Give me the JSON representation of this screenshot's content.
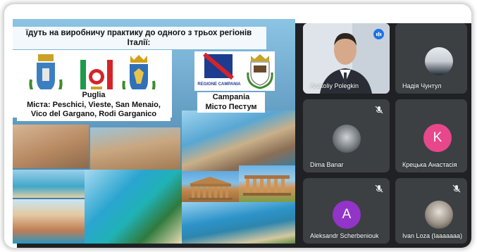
{
  "slide": {
    "title_line1": "їдуть на виробничу практику до одного з трьох регіонів",
    "title_line2": "Італії:",
    "puglia": {
      "region": "Puglia",
      "cities_line1": "Міста: Peschici, Vieste, San Menaio,",
      "cities_line2": "Vico del Gargano, Rodi Garganico"
    },
    "campania": {
      "logo_text": "REGIONE CAMPANIA",
      "region": "Campania",
      "city": "Місто Пестум"
    }
  },
  "participants": [
    {
      "name": "Anatoliy Polegkin",
      "status": "speaking",
      "avatar_type": "photo"
    },
    {
      "name": "Надія Чунтул",
      "status": "muted",
      "avatar_type": "photo"
    },
    {
      "name": "Dima Banar",
      "status": "muted",
      "avatar_type": "photo"
    },
    {
      "name": "Крецька Анастасія",
      "status": "unmuted",
      "avatar_type": "letter",
      "letter": "K",
      "color": "#e8478c"
    },
    {
      "name": "Aleksandr Scherbeniouk",
      "status": "muted",
      "avatar_type": "letter",
      "letter": "A",
      "color": "#9334c9"
    },
    {
      "name": "Ivan Loza (Iaaaaaaa)",
      "status": "muted",
      "avatar_type": "photo"
    }
  ],
  "colors": {
    "meet_background": "#202124",
    "tile_background": "#3c4043",
    "speaking_accent": "#1a73e8"
  }
}
